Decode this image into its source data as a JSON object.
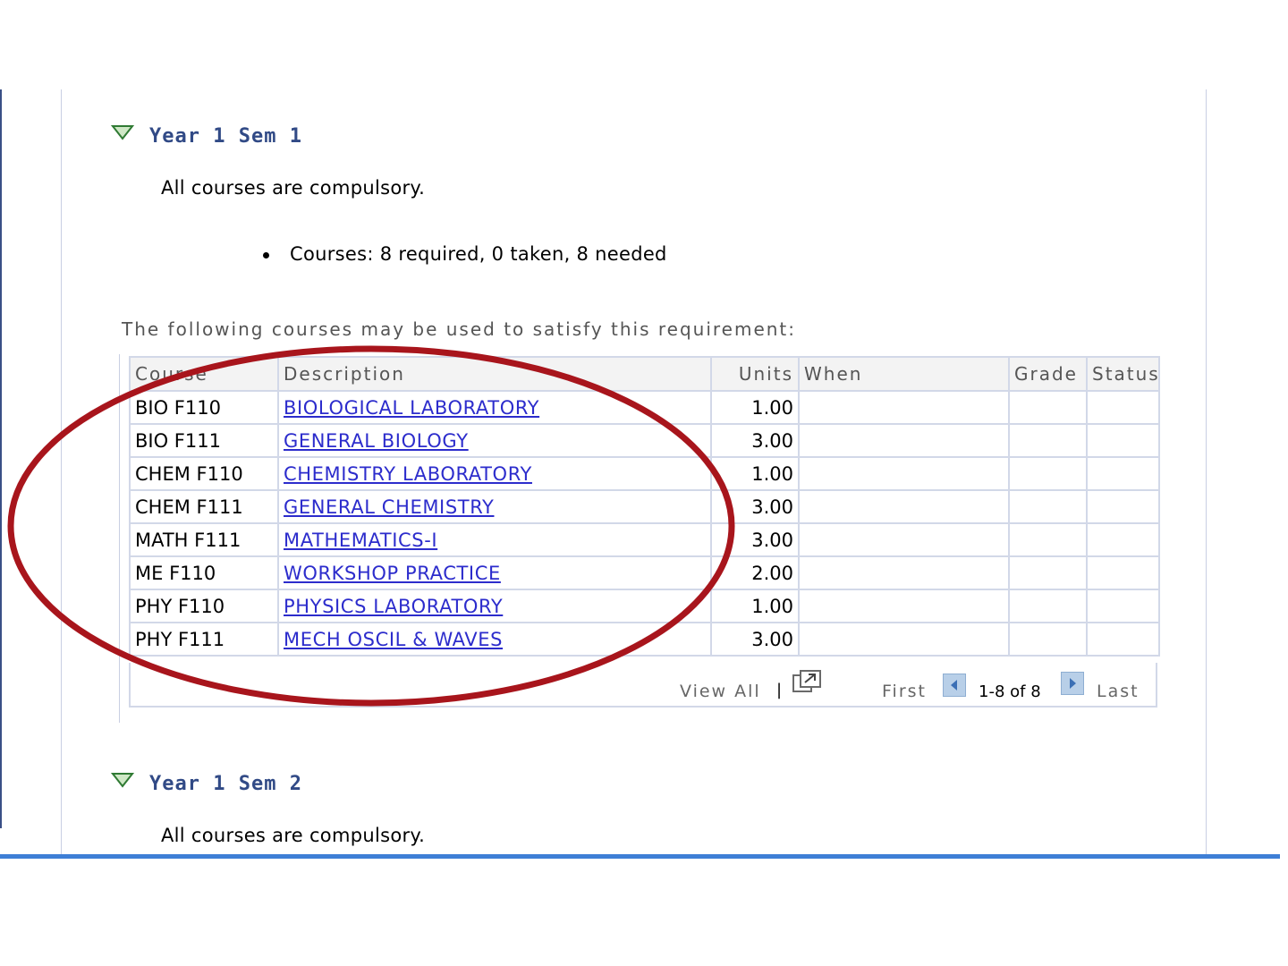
{
  "sections": [
    {
      "title": "Year 1 Sem 1",
      "note": "All courses are compulsory.",
      "requirement": "Courses: 8 required, 0 taken, 8 needed",
      "intro": "The following courses may be used to satisfy this requirement:"
    },
    {
      "title": "Year 1 Sem 2",
      "note": "All courses are compulsory."
    }
  ],
  "table": {
    "headers": [
      "Course",
      "Description",
      "Units",
      "When",
      "Grade",
      "Status"
    ],
    "rows": [
      {
        "course": "BIO F110",
        "description": "BIOLOGICAL LABORATORY",
        "units": "1.00"
      },
      {
        "course": "BIO F111",
        "description": "GENERAL BIOLOGY",
        "units": "3.00"
      },
      {
        "course": "CHEM F110",
        "description": "CHEMISTRY LABORATORY",
        "units": "1.00"
      },
      {
        "course": "CHEM F111",
        "description": "GENERAL CHEMISTRY",
        "units": "3.00"
      },
      {
        "course": "MATH F111",
        "description": "MATHEMATICS-I",
        "units": "3.00"
      },
      {
        "course": "ME F110",
        "description": "WORKSHOP PRACTICE",
        "units": "2.00"
      },
      {
        "course": "PHY F110",
        "description": "PHYSICS LABORATORY",
        "units": "1.00"
      },
      {
        "course": "PHY F111",
        "description": "MECH OSCIL & WAVES",
        "units": "3.00"
      }
    ],
    "footer": {
      "view_all": "View All",
      "separator": "|",
      "first": "First",
      "range": "1-8 of 8",
      "last": "Last"
    }
  },
  "icons": {
    "collapse": "triangle-down-icon",
    "zoom": "new-window-icon",
    "prev": "arrow-left-icon",
    "next": "arrow-right-icon"
  },
  "colors": {
    "section_title": "#314a86",
    "link": "#2c2ccc",
    "annotation": "#a8151c",
    "nav_button": "#b8cfe8"
  }
}
